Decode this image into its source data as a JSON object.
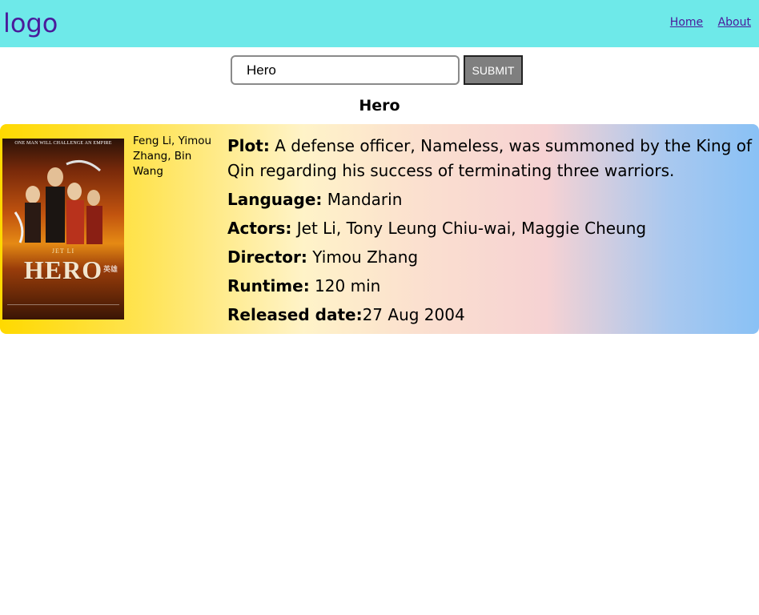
{
  "header": {
    "logo": "logo",
    "nav": {
      "home": "Home",
      "about": "About"
    }
  },
  "search": {
    "value": "Hero",
    "submit_label": "SUBMIT"
  },
  "result": {
    "title": "Hero",
    "poster": {
      "tagline": "ONE MAN WILL CHALLENGE AN EMPIRE",
      "actor": "JET LI",
      "title": "HERO",
      "chinese_title": "英雄"
    },
    "writers": "Feng Li, Yimou Zhang, Bin Wang",
    "plot_label": "Plot:",
    "plot": " A defense officer, Nameless, was summoned by the King of Qin regarding his success of terminating three warriors.",
    "language_label": "Language:",
    "language": " Mandarin",
    "actors_label": "Actors:",
    "actors": " Jet Li, Tony Leung Chiu-wai, Maggie Cheung",
    "director_label": "Director:",
    "director": " Yimou Zhang",
    "runtime_label": "Runtime:",
    "runtime": " 120 min",
    "released_label": "Released date:",
    "released": "27 Aug 2004"
  },
  "colors": {
    "header_bg": "#6ee9e9",
    "logo_color": "#4a1b9b",
    "submit_bg": "#7f7f7f"
  }
}
